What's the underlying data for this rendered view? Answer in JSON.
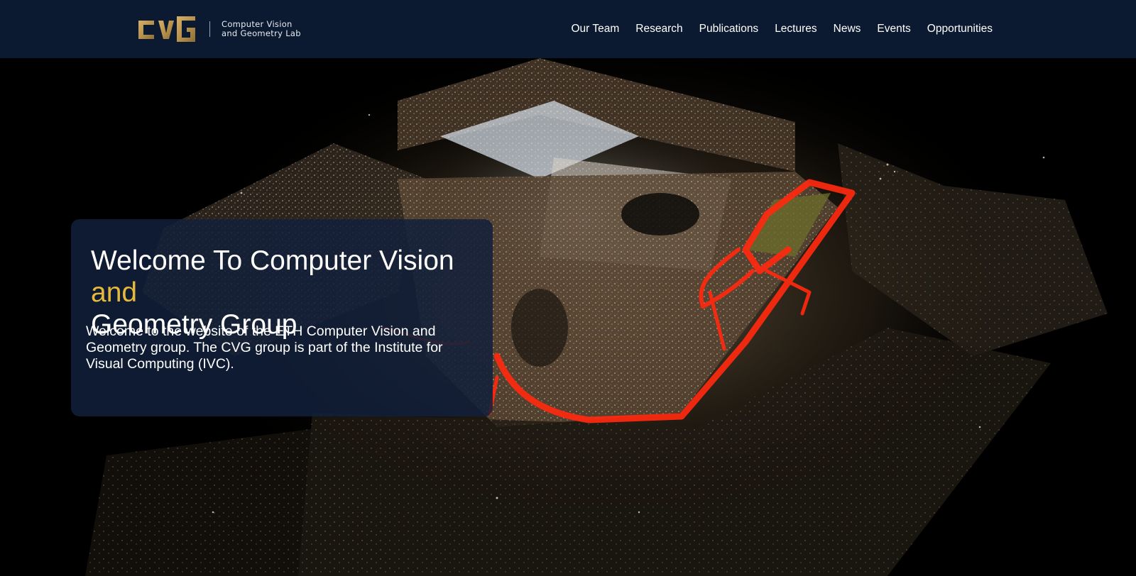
{
  "header": {
    "logo": {
      "wordmark": "CVG",
      "line1": "Computer Vision",
      "line2": "and Geometry Lab"
    },
    "nav": [
      "Our Team",
      "Research",
      "Publications",
      "Lectures",
      "News",
      "Events",
      "Opportunities"
    ]
  },
  "hero": {
    "title_part1": "Welcome To Computer Vision ",
    "title_accent": "and",
    "title_part2": "Geometry Group",
    "description": "Welcome to the website of the ETH Computer Vision and Geometry group. The CVG group is part of the Institute for Visual Computing (IVC).",
    "image": "3D point cloud reconstruction of a building complex with a red trajectory"
  },
  "colors": {
    "navbar_bg": "#0b1a30",
    "accent_gold": "#e7b93a",
    "card_bg": "#12203a",
    "trajectory_red": "#ff2a10"
  }
}
